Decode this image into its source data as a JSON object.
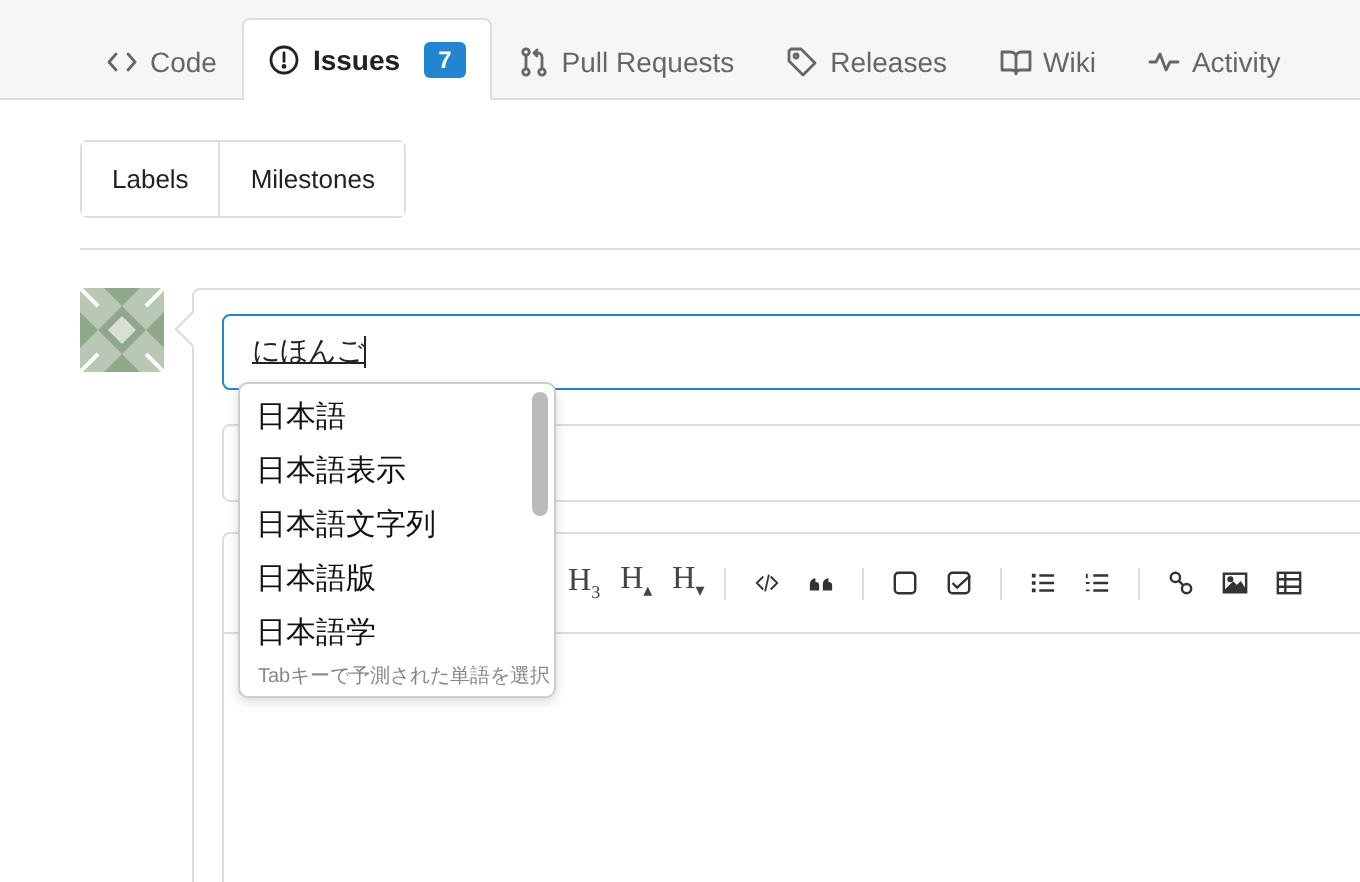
{
  "tabs": [
    {
      "label": "Code",
      "kind": "code",
      "selected": false
    },
    {
      "label": "Issues",
      "kind": "issue",
      "selected": true,
      "count": "7"
    },
    {
      "label": "Pull Requests",
      "kind": "pull",
      "selected": false
    },
    {
      "label": "Releases",
      "kind": "tag",
      "selected": false
    },
    {
      "label": "Wiki",
      "kind": "book",
      "selected": false
    },
    {
      "label": "Activity",
      "kind": "pulse",
      "selected": false
    }
  ],
  "filter_buttons": [
    "Labels",
    "Milestones"
  ],
  "title_field": {
    "value": "にほんご"
  },
  "suggestions": {
    "items": [
      {
        "label": "日本語",
        "selected": false
      },
      {
        "label": "日本語表示",
        "selected": false
      },
      {
        "label": "日本語文字列",
        "selected": false
      },
      {
        "label": "日本語版",
        "selected": false
      },
      {
        "label": "日本語学",
        "selected": false
      }
    ],
    "hint": "Tabキーで予測された単語を選択"
  },
  "toolbar": [
    {
      "kind": "text",
      "label": "H$_{3}$"
    },
    {
      "kind": "text",
      "label": "H$_{▴}$"
    },
    {
      "kind": "text",
      "label": "H$_{▾}$"
    },
    {
      "kind": "separator"
    },
    {
      "kind": "code"
    },
    {
      "kind": "quote"
    },
    {
      "kind": "separator"
    },
    {
      "kind": "checkbox"
    },
    {
      "kind": "checked"
    },
    {
      "kind": "separator"
    },
    {
      "kind": "ul"
    },
    {
      "kind": "ol"
    },
    {
      "kind": "separator"
    },
    {
      "kind": "link"
    },
    {
      "kind": "image"
    },
    {
      "kind": "table"
    }
  ]
}
